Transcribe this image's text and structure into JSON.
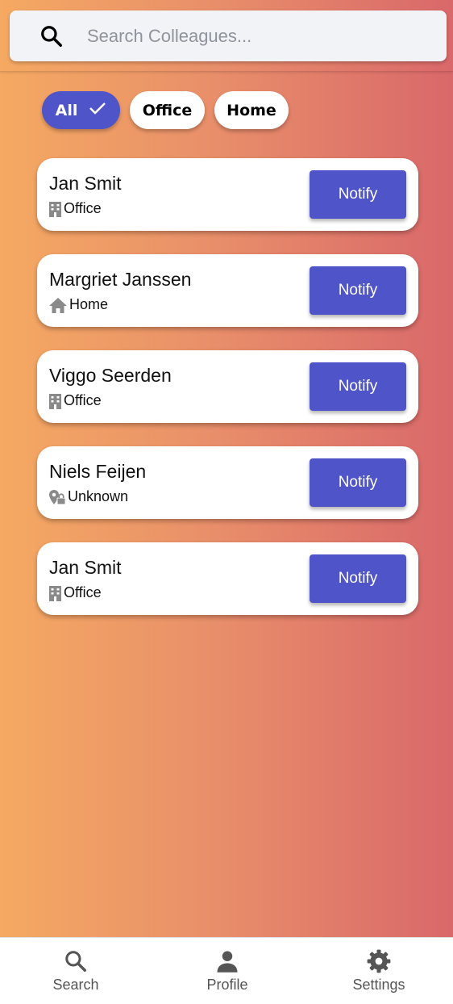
{
  "search": {
    "placeholder": "Search Colleagues..."
  },
  "filters": [
    {
      "label": "All",
      "selected": true
    },
    {
      "label": "Office",
      "selected": false
    },
    {
      "label": "Home",
      "selected": false
    }
  ],
  "colleagues": [
    {
      "name": "Jan Smit",
      "status": "Office",
      "status_icon": "building-icon",
      "action": "Notify"
    },
    {
      "name": "Margriet Janssen",
      "status": "Home",
      "status_icon": "home-icon",
      "action": "Notify"
    },
    {
      "name": "Viggo Seerden",
      "status": "Office",
      "status_icon": "building-icon",
      "action": "Notify"
    },
    {
      "name": "Niels Feijen",
      "status": "Unknown",
      "status_icon": "location-locked-icon",
      "action": "Notify"
    },
    {
      "name": "Jan Smit",
      "status": "Office",
      "status_icon": "building-icon",
      "action": "Notify"
    }
  ],
  "nav": [
    {
      "label": "Search",
      "icon": "search-icon"
    },
    {
      "label": "Profile",
      "icon": "person-icon"
    },
    {
      "label": "Settings",
      "icon": "gear-icon"
    }
  ],
  "colors": {
    "accent": "#4f55c9",
    "gradient_start": "#f5a962",
    "gradient_end": "#d9686a"
  }
}
